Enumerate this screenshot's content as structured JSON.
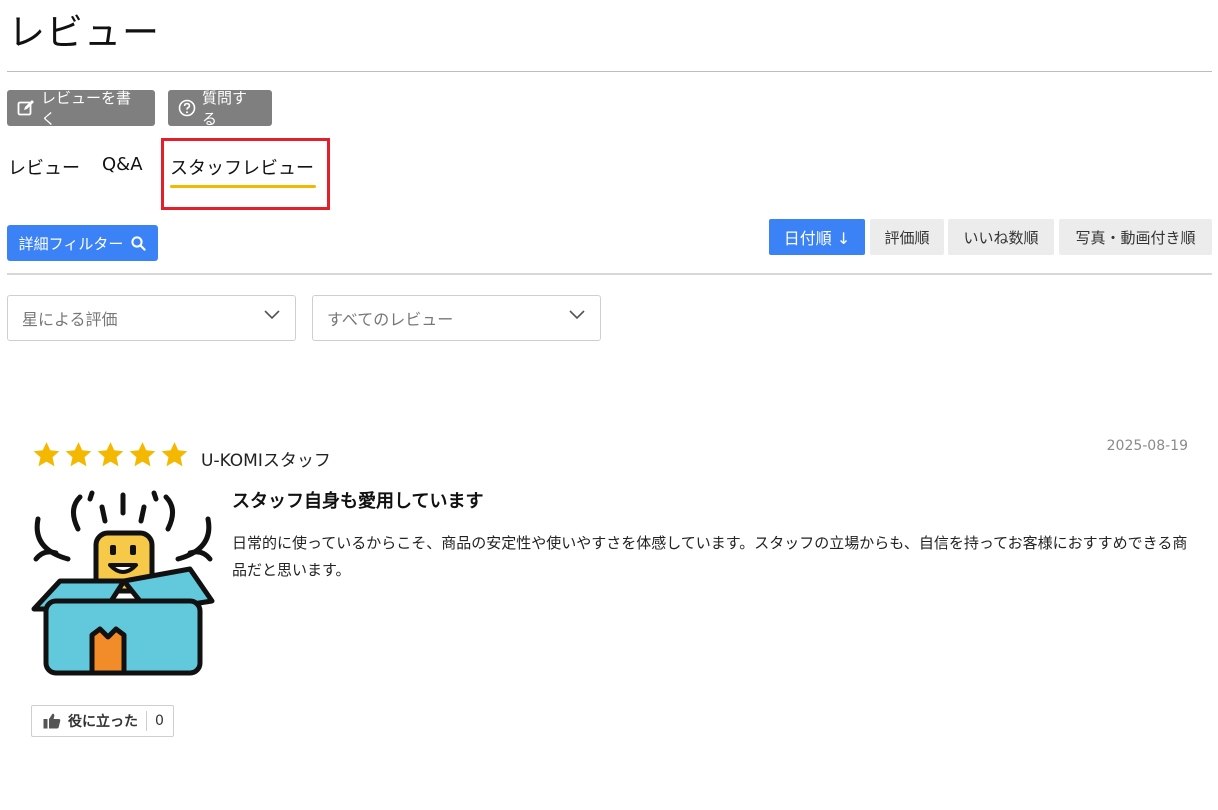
{
  "header": {
    "title": "レビュー"
  },
  "actions": {
    "write_review": "レビューを書く",
    "ask_question": "質問する"
  },
  "tabs": [
    {
      "label": "レビュー"
    },
    {
      "label": "Q&A"
    },
    {
      "label": "スタッフレビュー",
      "active": true
    }
  ],
  "filter": {
    "label": "詳細フィルター"
  },
  "sort": [
    {
      "label": "日付順 ↓",
      "active": true
    },
    {
      "label": "評価順"
    },
    {
      "label": "いいね数順"
    },
    {
      "label": "写真・動画付き順"
    }
  ],
  "selects": {
    "stars": "星による評価",
    "reviews": "すべてのレビュー"
  },
  "review": {
    "rating": 5,
    "reviewer": "U-KOMIスタッフ",
    "date": "2025-08-19",
    "title": "スタッフ自身も愛用しています",
    "body": "日常的に使っているからこそ、商品の安定性や使いやすさを体感しています。スタッフの立場からも、自信を持ってお客様におすすめできる商品だと思います。",
    "helpful_label": "役に立った",
    "helpful_count": "0"
  },
  "colors": {
    "accent": "#3b82f6",
    "star": "#f5b800",
    "tab_underline": "#f5b800",
    "highlight": "#e3202a"
  }
}
